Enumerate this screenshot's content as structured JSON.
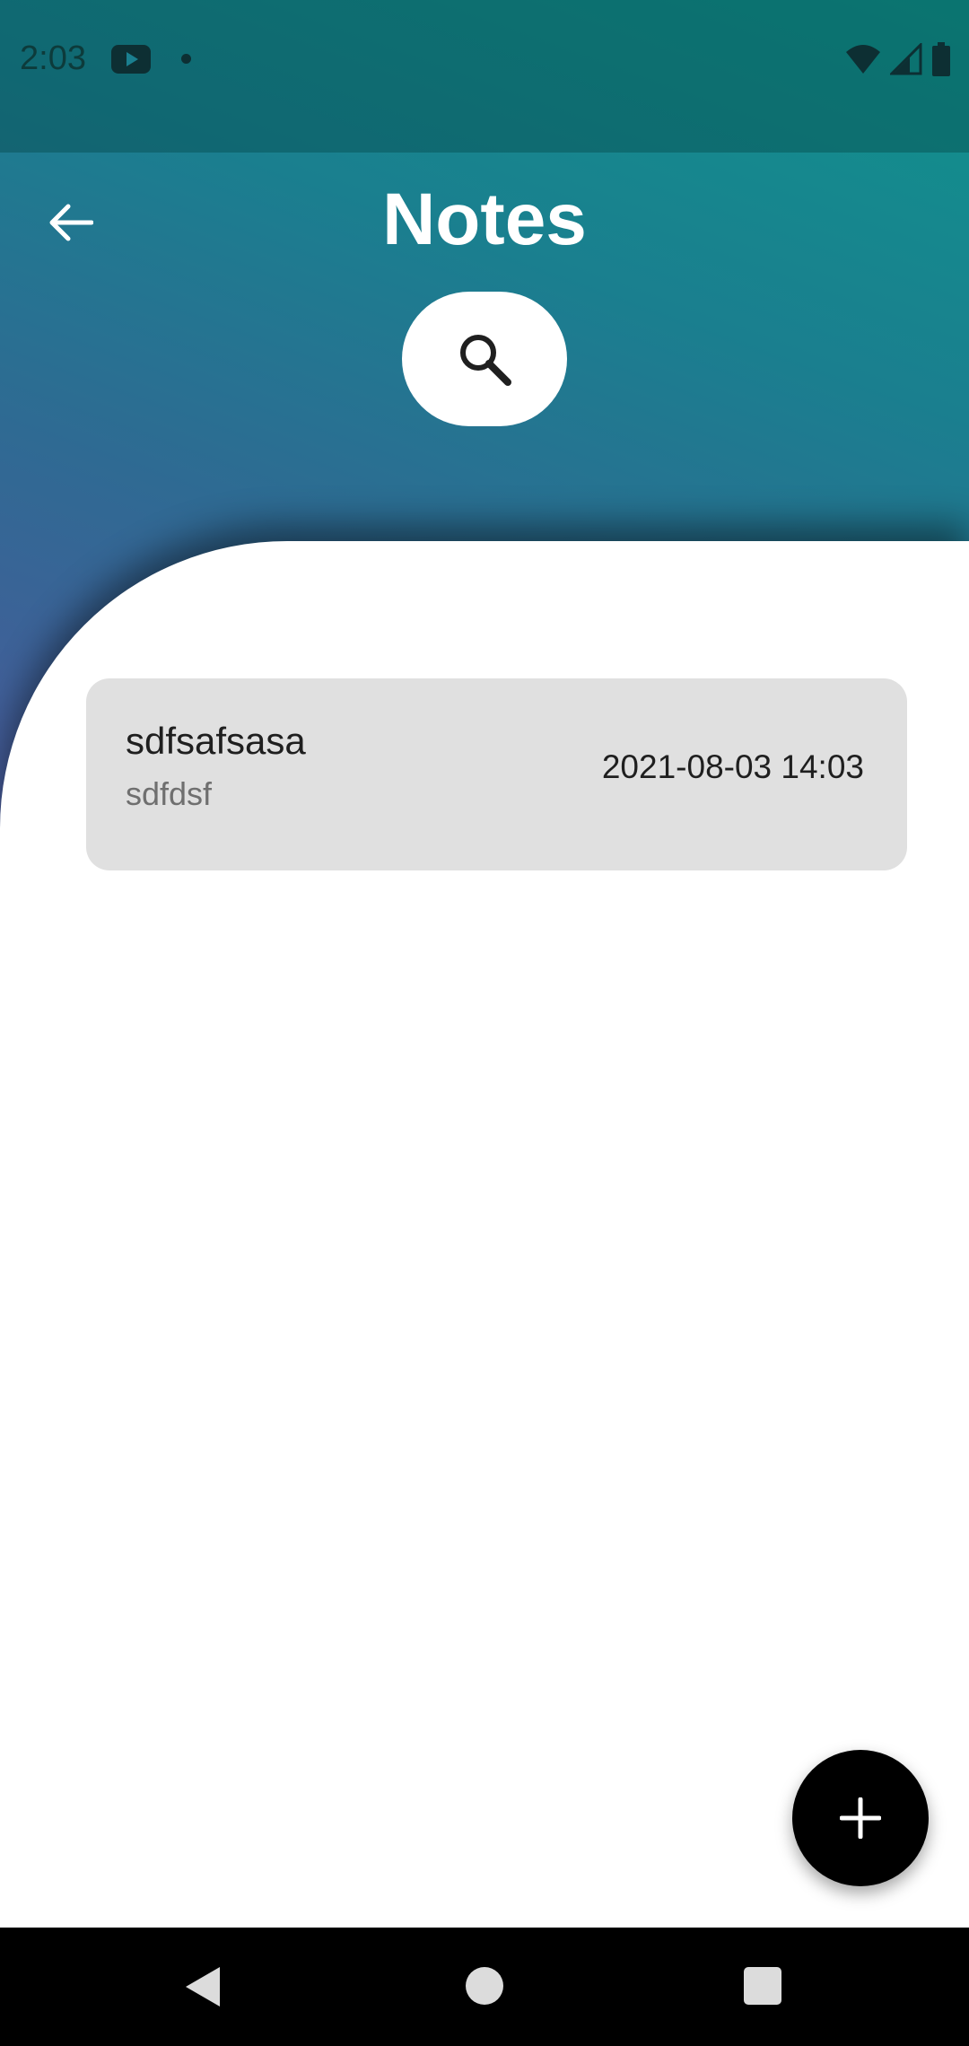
{
  "status_bar": {
    "time": "2:03",
    "icons": [
      "youtube-icon",
      "notification-dot-icon",
      "wifi-icon",
      "signal-icon",
      "battery-icon"
    ]
  },
  "header": {
    "title": "Notes",
    "back_icon": "arrow-left-icon",
    "search_icon": "search-icon"
  },
  "notes": [
    {
      "title": "sdfsafsasa",
      "body": "sdfdsf",
      "date": "2021-08-03 14:03"
    }
  ],
  "fab": {
    "icon": "plus-icon"
  },
  "nav": {
    "icons": [
      "nav-back-icon",
      "nav-home-icon",
      "nav-recents-icon"
    ]
  },
  "colors": {
    "gradient_top": "#10938c",
    "gradient_bottom": "#4a5a9c",
    "card_bg": "#e0e0e0",
    "fab_bg": "#000000"
  }
}
